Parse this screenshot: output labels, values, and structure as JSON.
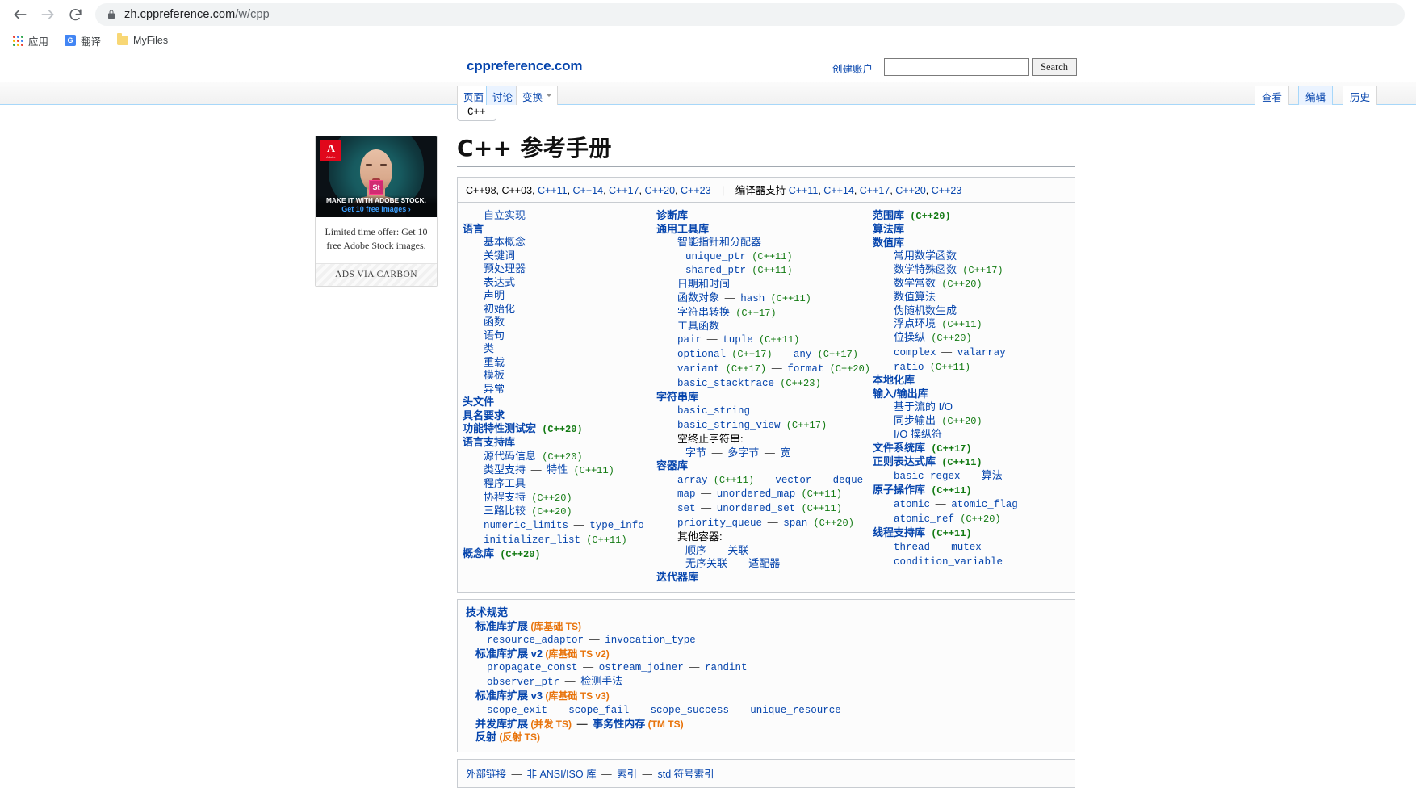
{
  "browser": {
    "back_icon": "back-arrow-icon",
    "forward_icon": "forward-arrow-icon",
    "reload_icon": "reload-icon",
    "lock_icon": "lock-icon",
    "url_main": "zh.cppreference.com",
    "url_path": "/w/cpp",
    "bookmarks": [
      {
        "icon": "apps-grid-icon",
        "label": "应用"
      },
      {
        "icon": "google-translate-icon",
        "label": "翻译"
      },
      {
        "icon": "folder-icon",
        "label": "MyFiles"
      }
    ]
  },
  "site": {
    "logo": "cppreference.com",
    "create_account": "创建账户",
    "search_value": "",
    "search_button": "Search",
    "tabs": [
      {
        "label": "页面",
        "selected": false
      },
      {
        "label": "讨论",
        "selected": true
      },
      {
        "label": "变换",
        "selected": false
      }
    ],
    "right_tabs": [
      {
        "label": "查看",
        "selected": false
      },
      {
        "label": "编辑",
        "selected": true
      },
      {
        "label": "历史",
        "selected": false
      }
    ],
    "subtab": "C++"
  },
  "ad": {
    "brand": "Adobe",
    "brand_letter": "A",
    "stock_badge": "St",
    "headline": "MAKE IT WITH ADOBE STOCK.",
    "cta": "Get 10 free images ›",
    "body": "Limited time offer: Get 10 free Adobe Stock images.",
    "via": "ADS VIA CARBON"
  },
  "article": {
    "title": "C++ 参考手册",
    "std_bar": {
      "standards": [
        "C++98",
        "C++03",
        "C++11",
        "C++14",
        "C++17",
        "C++20",
        "C++23"
      ],
      "standards_plain_count": 2,
      "compiler_label": "编译器支持",
      "compiler_standards": [
        "C++11",
        "C++14",
        "C++17",
        "C++20",
        "C++23"
      ]
    },
    "col1": [
      {
        "t": "自立实现",
        "k": "sub"
      },
      {
        "t": "语言",
        "k": "h"
      },
      {
        "t": "基本概念",
        "k": "sub"
      },
      {
        "t": "关键词",
        "k": "sub"
      },
      {
        "t": "预处理器",
        "k": "sub"
      },
      {
        "t": "表达式",
        "k": "sub"
      },
      {
        "t": "声明",
        "k": "sub"
      },
      {
        "t": "初始化",
        "k": "sub"
      },
      {
        "t": "函数",
        "k": "sub"
      },
      {
        "t": "语句",
        "k": "sub"
      },
      {
        "t": "类",
        "k": "sub"
      },
      {
        "t": "重载",
        "k": "sub"
      },
      {
        "t": "模板",
        "k": "sub"
      },
      {
        "t": "异常",
        "k": "sub"
      },
      {
        "t": "头文件",
        "k": "h"
      },
      {
        "t": "具名要求",
        "k": "h"
      },
      {
        "t": "功能特性测试宏",
        "k": "h",
        "v": "(C++20)"
      },
      {
        "t": "语言支持库",
        "k": "h"
      },
      {
        "t": "源代码信息",
        "k": "sub",
        "v": "(C++20)"
      },
      {
        "t": "类型支持",
        "k": "sub",
        "d": "特性",
        "dv": "(C++11)"
      },
      {
        "t": "程序工具",
        "k": "sub"
      },
      {
        "t": "协程支持",
        "k": "sub",
        "v": "(C++20)"
      },
      {
        "t": "三路比较",
        "k": "sub",
        "v": "(C++20)"
      },
      {
        "t": "numeric_limits",
        "k": "sub",
        "mono": true,
        "d": "type_info",
        "dmono": true
      },
      {
        "t": "initializer_list",
        "k": "sub",
        "mono": true,
        "v": "(C++11)"
      },
      {
        "t": "概念库",
        "k": "h",
        "v": "(C++20)"
      }
    ],
    "col2": [
      {
        "t": "诊断库",
        "k": "h"
      },
      {
        "t": "通用工具库",
        "k": "h"
      },
      {
        "t": "智能指针和分配器",
        "k": "sub"
      },
      {
        "t": "unique_ptr",
        "k": "sub2",
        "mono": true,
        "v": "(C++11)"
      },
      {
        "t": "shared_ptr",
        "k": "sub2",
        "mono": true,
        "v": "(C++11)"
      },
      {
        "t": "日期和时间",
        "k": "sub"
      },
      {
        "t": "函数对象",
        "k": "sub",
        "d": "hash",
        "dmono": true,
        "dv": "(C++11)"
      },
      {
        "t": "字符串转换",
        "k": "sub",
        "v": "(C++17)"
      },
      {
        "t": "工具函数",
        "k": "sub"
      },
      {
        "t": "pair",
        "k": "sub",
        "mono": true,
        "d": "tuple",
        "dmono": true,
        "dv": "(C++11)"
      },
      {
        "t": "optional",
        "k": "sub",
        "mono": true,
        "v": "(C++17)",
        "d": "any",
        "dmono": true,
        "dv": "(C++17)"
      },
      {
        "t": "variant",
        "k": "sub",
        "mono": true,
        "v": "(C++17)",
        "d": "format",
        "dmono": true,
        "dv": "(C++20)"
      },
      {
        "t": "basic_stacktrace",
        "k": "sub",
        "mono": true,
        "v": "(C++23)"
      },
      {
        "t": "字符串库",
        "k": "h"
      },
      {
        "t": "basic_string",
        "k": "sub",
        "mono": true
      },
      {
        "t": "basic_string_view",
        "k": "sub",
        "mono": true,
        "v": "(C++17)"
      },
      {
        "t": "空终止字符串:",
        "k": "sub",
        "plain": true
      },
      {
        "t": "字节",
        "k": "sub2",
        "d": "多字节",
        "d2": "宽"
      },
      {
        "t": "容器库",
        "k": "h"
      },
      {
        "t": "array",
        "k": "sub",
        "mono": true,
        "v": "(C++11)",
        "d": "vector",
        "dmono": true,
        "d2": "deque",
        "d2mono": true
      },
      {
        "t": "map",
        "k": "sub",
        "mono": true,
        "d": "unordered_map",
        "dmono": true,
        "dv": "(C++11)"
      },
      {
        "t": "set",
        "k": "sub",
        "mono": true,
        "d": "unordered_set",
        "dmono": true,
        "dv": "(C++11)"
      },
      {
        "t": "priority_queue",
        "k": "sub",
        "mono": true,
        "d": "span",
        "dmono": true,
        "dv": "(C++20)"
      },
      {
        "t": "其他容器:",
        "k": "sub",
        "plain": true
      },
      {
        "t": "顺序",
        "k": "sub2",
        "d": "关联"
      },
      {
        "t": "无序关联",
        "k": "sub2",
        "d": "适配器"
      },
      {
        "t": "迭代器库",
        "k": "h"
      }
    ],
    "col3": [
      {
        "t": "范围库",
        "k": "h",
        "v": "(C++20)"
      },
      {
        "t": "算法库",
        "k": "h"
      },
      {
        "t": "数值库",
        "k": "h"
      },
      {
        "t": "常用数学函数",
        "k": "sub"
      },
      {
        "t": "数学特殊函数",
        "k": "sub",
        "v": "(C++17)"
      },
      {
        "t": "数学常数",
        "k": "sub",
        "v": "(C++20)"
      },
      {
        "t": "数值算法",
        "k": "sub"
      },
      {
        "t": "伪随机数生成",
        "k": "sub"
      },
      {
        "t": "浮点环境",
        "k": "sub",
        "v": "(C++11)"
      },
      {
        "t": "位操纵",
        "k": "sub",
        "v": "(C++20)"
      },
      {
        "t": "complex",
        "k": "sub",
        "mono": true,
        "d": "valarray",
        "dmono": true
      },
      {
        "t": "ratio",
        "k": "sub",
        "mono": true,
        "v": "(C++11)"
      },
      {
        "t": "本地化库",
        "k": "h"
      },
      {
        "t": "输入/输出库",
        "k": "h"
      },
      {
        "t": "基于流的 I/O",
        "k": "sub"
      },
      {
        "t": "同步输出",
        "k": "sub",
        "v": "(C++20)"
      },
      {
        "t": "I/O 操纵符",
        "k": "sub"
      },
      {
        "t": "文件系统库",
        "k": "h",
        "v": "(C++17)"
      },
      {
        "t": "正则表达式库",
        "k": "h",
        "v": "(C++11)"
      },
      {
        "t": "basic_regex",
        "k": "sub",
        "mono": true,
        "d": "算法"
      },
      {
        "t": "原子操作库",
        "k": "h",
        "v": "(C++11)"
      },
      {
        "t": "atomic",
        "k": "sub",
        "mono": true,
        "d": "atomic_flag",
        "dmono": true
      },
      {
        "t": "atomic_ref",
        "k": "sub",
        "mono": true,
        "v": "(C++20)"
      },
      {
        "t": "线程支持库",
        "k": "h",
        "v": "(C++11)"
      },
      {
        "t": "thread",
        "k": "sub",
        "mono": true,
        "d": "mutex",
        "dmono": true
      },
      {
        "t": "condition_variable",
        "k": "sub",
        "mono": true
      }
    ],
    "ts": [
      {
        "t": "技术规范",
        "k": "h"
      },
      {
        "t": "标准库扩展",
        "k": "h",
        "ind": true,
        "note": "(库基础 TS)"
      },
      {
        "t": "resource_adaptor",
        "k": "sub",
        "mono": true,
        "d": "invocation_type",
        "dmono": true
      },
      {
        "t": "标准库扩展 v2",
        "k": "h",
        "ind": true,
        "note": "(库基础 TS v2)"
      },
      {
        "t": "propagate_const",
        "k": "sub",
        "mono": true,
        "d": "ostream_joiner",
        "dmono": true,
        "d2": "randint",
        "d2mono": true
      },
      {
        "t": "observer_ptr",
        "k": "sub",
        "mono": true,
        "d": "检测手法"
      },
      {
        "t": "标准库扩展 v3",
        "k": "h",
        "ind": true,
        "note": "(库基础 TS v3)"
      },
      {
        "t": "scope_exit",
        "k": "sub",
        "mono": true,
        "d": "scope_fail",
        "dmono": true,
        "d2": "scope_success",
        "d2mono": true,
        "d3": "unique_resource",
        "d3mono": true
      },
      {
        "t": "并发库扩展",
        "k": "h",
        "ind": true,
        "note": "(并发 TS)",
        "d": "事务性内存",
        "dbold": true,
        "dnote": "(TM TS)"
      },
      {
        "t": "反射",
        "k": "h",
        "ind": true,
        "note": "(反射 TS)"
      }
    ],
    "footer": [
      {
        "t": "外部链接"
      },
      {
        "t": "非 ANSI/ISO 库"
      },
      {
        "t": "索引"
      },
      {
        "t": "std 符号索引"
      }
    ]
  },
  "colors": {
    "link": "#0645ad",
    "version": "#127a12",
    "ts_note": "#e8740c",
    "panel_border": "#c8ccd1"
  }
}
